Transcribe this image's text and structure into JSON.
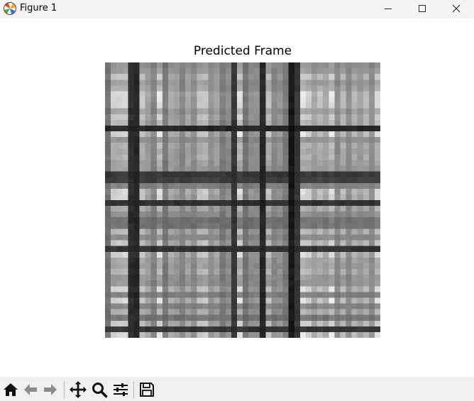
{
  "window": {
    "title": "Figure 1",
    "controls": [
      "minimize",
      "maximize",
      "close"
    ]
  },
  "figure": {
    "title": "Predicted Frame",
    "colormap": "gray",
    "image_grid": {
      "rows": 48,
      "cols": 48
    }
  },
  "toolbar": {
    "buttons": [
      {
        "name": "home-icon",
        "tooltip": "Reset original view"
      },
      {
        "name": "back-icon",
        "tooltip": "Back to previous view"
      },
      {
        "name": "forward-icon",
        "tooltip": "Forward to next view"
      },
      {
        "name": "pan-icon",
        "tooltip": "Pan axes"
      },
      {
        "name": "zoom-icon",
        "tooltip": "Zoom to rectangle"
      },
      {
        "name": "configure-subplots-icon",
        "tooltip": "Configure subplots"
      },
      {
        "name": "save-icon",
        "tooltip": "Save the figure"
      }
    ]
  },
  "colors": {
    "titlebar": "#f3f3f3",
    "toolbar": "#f0f0f0",
    "canvas": "#ffffff"
  }
}
